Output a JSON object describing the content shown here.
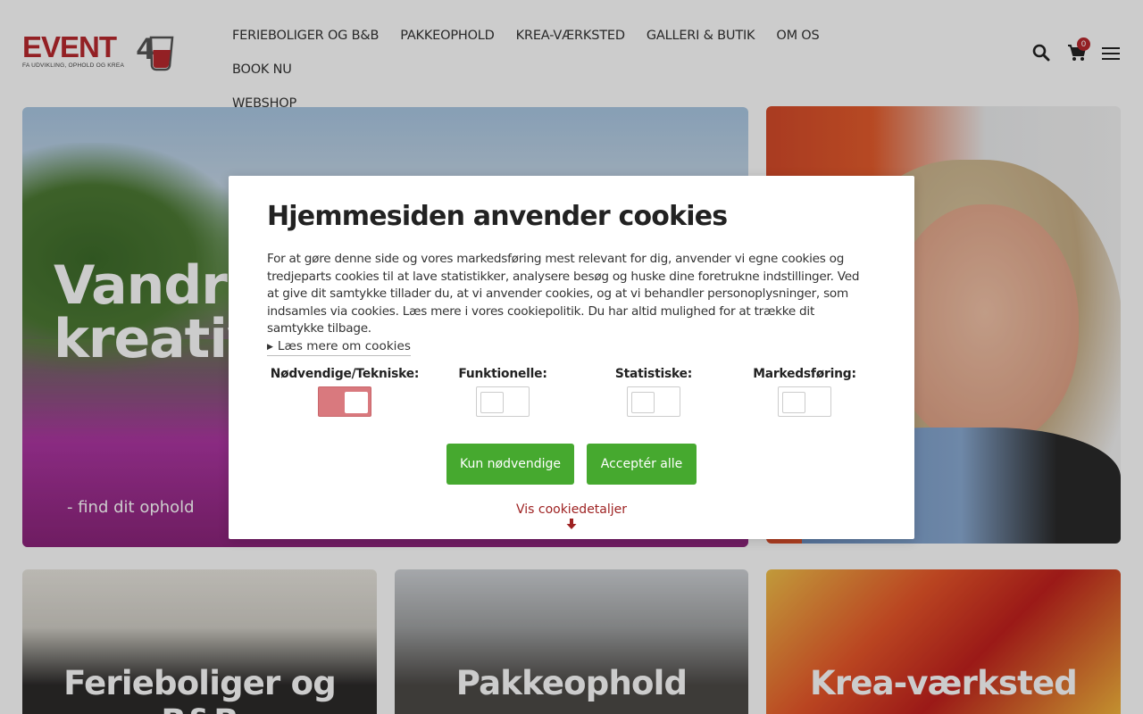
{
  "brand": {
    "logo_text": "EVENT4U",
    "logo_tagline": "FA UDVIKLING, OPHOLD OG KREA",
    "accent_color": "#b8282e"
  },
  "nav": {
    "items": [
      {
        "label": "FERIEBOLIGER OG B&B"
      },
      {
        "label": "PAKKEOPHOLD"
      },
      {
        "label": "KREA-VÆRKSTED"
      },
      {
        "label": "GALLERI & BUTIK"
      },
      {
        "label": "OM OS"
      },
      {
        "label": "BOOK NU"
      },
      {
        "label": "WEBSHOP"
      }
    ],
    "cart_count": "0",
    "icons": [
      "search-icon",
      "cart-icon",
      "menu-icon"
    ]
  },
  "hero": {
    "title": "Vandr og kreativ familie",
    "subtitle": "- find dit ophold"
  },
  "cards": [
    {
      "label": "Ferieboliger og B&B"
    },
    {
      "label": "Pakkeophold"
    },
    {
      "label": "Krea-værksted"
    }
  ],
  "cookie_dialog": {
    "title": "Hjemmesiden anvender cookies",
    "text": "For at gøre denne side og vores markedsføring mest relevant for dig, anvender vi egne cookies og tredjeparts cookies til at lave statistikker, analysere besøg og huske dine foretrukne indstillinger. Ved at give dit samtykke tillader du, at vi anvender cookies, og at vi behandler personoplysninger, som indsamles via cookies. Læs mere i vores cookiepolitik. Du har altid mulighed for at trække dit samtykke tilbage.",
    "read_more": "Læs mere om cookies",
    "categories": [
      {
        "label": "Nødvendige/Tekniske:",
        "checked": true
      },
      {
        "label": "Funktionelle:",
        "checked": false
      },
      {
        "label": "Statistiske:",
        "checked": false
      },
      {
        "label": "Markedsføring:",
        "checked": false
      }
    ],
    "btn_necessary": "Kun nødvendige",
    "btn_accept_all": "Acceptér alle",
    "details_link": "Vis cookiedetaljer",
    "button_color": "#46a92f",
    "toggle_on_color": "#d9797e",
    "link_color": "#9e2222"
  }
}
